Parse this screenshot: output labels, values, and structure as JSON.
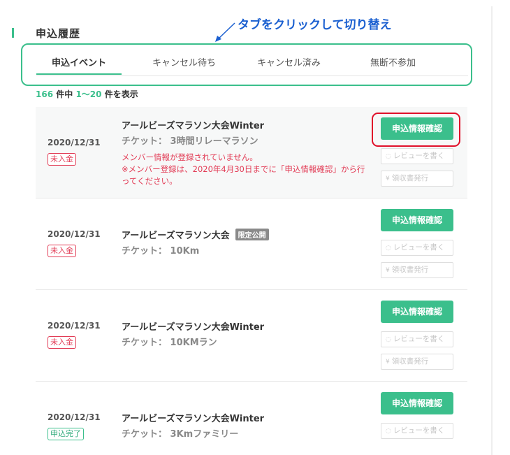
{
  "page": {
    "title": "申込履歴"
  },
  "annotation": {
    "text": "タブをクリックして切り替え"
  },
  "tabs": [
    {
      "label": "申込イベント",
      "active": true
    },
    {
      "label": "キャンセル待ち",
      "active": false
    },
    {
      "label": "キャンセル済み",
      "active": false
    },
    {
      "label": "無断不参加",
      "active": false
    }
  ],
  "results": {
    "total": "166",
    "total_suffix": "件中",
    "range": "1〜20",
    "range_suffix": "件を表示"
  },
  "buttons": {
    "confirm": "申込情報確認",
    "review": "レビューを書く",
    "receipt": "領収書発行"
  },
  "applications": [
    {
      "date": "2020/12/31",
      "status": "未入金",
      "status_type": "unpaid",
      "event": "アールビーズマラソン大会Winter",
      "ticket": "チケット： 3時間リレーマラソン",
      "warning_1": "メンバー情報が登録されていません。",
      "warning_2": "※メンバー登録は、2020年4月30日までに「申込情報確認」から行ってください。"
    },
    {
      "date": "2020/12/31",
      "status": "未入金",
      "status_type": "unpaid",
      "event": "アールビーズマラソン大会",
      "limited_label": "限定公開",
      "ticket": "チケット： 10Km"
    },
    {
      "date": "2020/12/31",
      "status": "未入金",
      "status_type": "unpaid",
      "event": "アールビーズマラソン大会Winter",
      "ticket": "チケット： 10KMラン"
    },
    {
      "date": "2020/12/31",
      "status": "申込完了",
      "status_type": "complete",
      "event": "アールビーズマラソン大会Winter",
      "ticket": "チケット： 3Kmファミリー"
    }
  ],
  "colors": {
    "accent": "#3bbf8c",
    "annotation": "#1a5fd0",
    "highlight": "#e0102a",
    "unpaid": "#e23b55"
  }
}
